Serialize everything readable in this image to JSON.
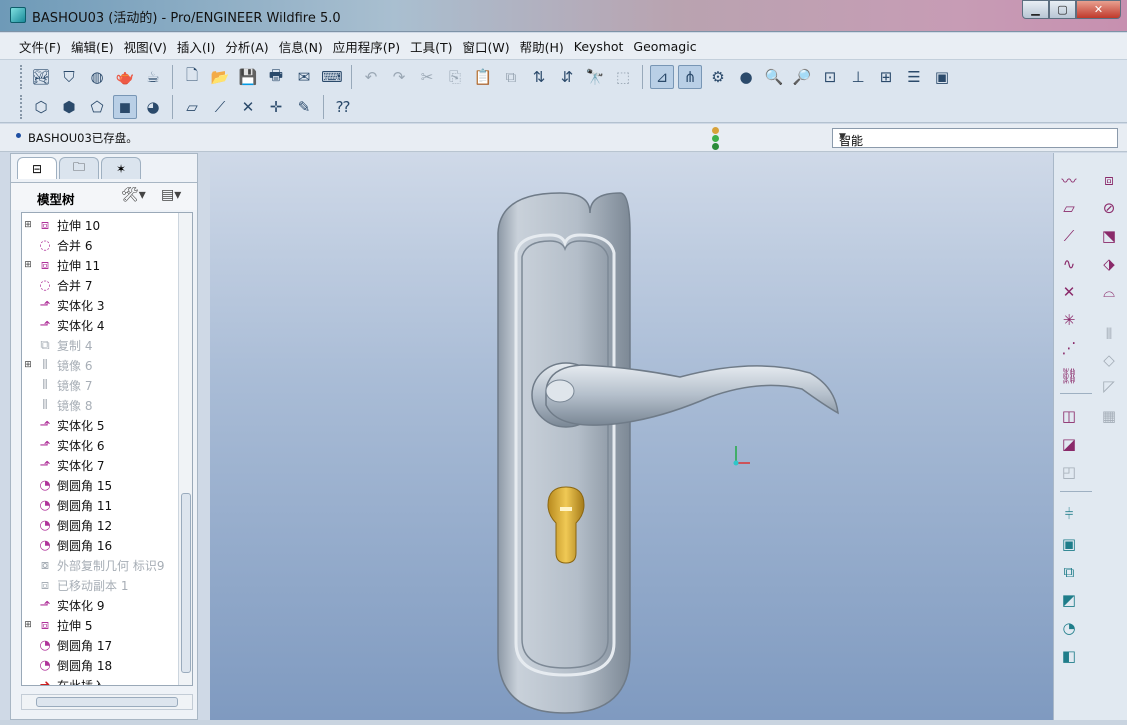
{
  "window": {
    "title": "BASHOU03 (活动的) - Pro/ENGINEER Wildfire 5.0"
  },
  "menu": [
    "文件(F)",
    "编辑(E)",
    "视图(V)",
    "插入(I)",
    "分析(A)",
    "信息(N)",
    "应用程序(P)",
    "工具(T)",
    "窗口(W)",
    "帮助(H)",
    "Keyshot",
    "Geomagic"
  ],
  "message": "BASHOU03已存盘。",
  "filter": {
    "value": "智能"
  },
  "model_tree": {
    "title": "模型树",
    "items": [
      {
        "label": "拉伸 10",
        "icon": "extrude-icon",
        "expandable": true,
        "dim": false
      },
      {
        "label": "合并 6",
        "icon": "merge-icon",
        "expandable": false,
        "dim": false
      },
      {
        "label": "拉伸 11",
        "icon": "extrude-icon",
        "expandable": true,
        "dim": false
      },
      {
        "label": "合并 7",
        "icon": "merge-icon",
        "expandable": false,
        "dim": false
      },
      {
        "label": "实体化 3",
        "icon": "solidify-icon",
        "expandable": false,
        "dim": false
      },
      {
        "label": "实体化 4",
        "icon": "solidify-icon",
        "expandable": false,
        "dim": false
      },
      {
        "label": "复制 4",
        "icon": "copy-icon",
        "expandable": false,
        "dim": true
      },
      {
        "label": "镜像 6",
        "icon": "mirror-icon",
        "expandable": true,
        "dim": true
      },
      {
        "label": "镜像 7",
        "icon": "mirror-icon",
        "expandable": false,
        "dim": true
      },
      {
        "label": "镜像 8",
        "icon": "mirror-icon",
        "expandable": false,
        "dim": true
      },
      {
        "label": "实体化 5",
        "icon": "solidify-icon",
        "expandable": false,
        "dim": false
      },
      {
        "label": "实体化 6",
        "icon": "solidify-icon",
        "expandable": false,
        "dim": false
      },
      {
        "label": "实体化 7",
        "icon": "solidify-icon",
        "expandable": false,
        "dim": false
      },
      {
        "label": "倒圆角 15",
        "icon": "round-icon",
        "expandable": false,
        "dim": false
      },
      {
        "label": "倒圆角 11",
        "icon": "round-icon",
        "expandable": false,
        "dim": false
      },
      {
        "label": "倒圆角 12",
        "icon": "round-icon",
        "expandable": false,
        "dim": false
      },
      {
        "label": "倒圆角 16",
        "icon": "round-icon",
        "expandable": false,
        "dim": false
      },
      {
        "label": "外部复制几何 标识9",
        "icon": "external-copy-icon",
        "expandable": false,
        "dim": true
      },
      {
        "label": "已移动副本 1",
        "icon": "moved-copy-icon",
        "expandable": false,
        "dim": true
      },
      {
        "label": "实体化 9",
        "icon": "solidify-icon",
        "expandable": false,
        "dim": false
      },
      {
        "label": "拉伸 5",
        "icon": "extrude-icon",
        "expandable": true,
        "dim": false
      },
      {
        "label": "倒圆角 17",
        "icon": "round-icon",
        "expandable": false,
        "dim": false
      },
      {
        "label": "倒圆角 18",
        "icon": "round-icon",
        "expandable": false,
        "dim": false
      },
      {
        "label": "在此插入",
        "icon": "insert-here-arrow-icon",
        "expandable": false,
        "dim": false
      }
    ]
  },
  "colors": {
    "handle": "#b4bfcb",
    "lock_cylinder": "#e0b83a"
  }
}
